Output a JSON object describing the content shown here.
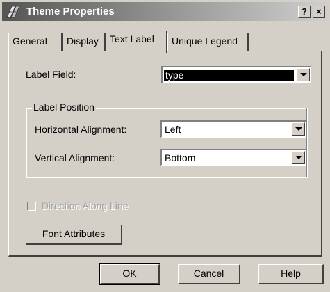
{
  "window": {
    "title": "Theme Properties",
    "help_glyph": "?",
    "close_glyph": "×",
    "icon": "theme-app-icon"
  },
  "tabs": [
    {
      "label": "General",
      "active": false
    },
    {
      "label": "Display",
      "active": false
    },
    {
      "label": "Text Label",
      "active": true
    },
    {
      "label": "Unique Legend",
      "active": false
    }
  ],
  "text_label": {
    "label_field_label": "Label Field:",
    "label_field_value": "type",
    "label_position": {
      "group_title": "Label Position",
      "horizontal_label": "Horizontal Alignment:",
      "horizontal_value": "Left",
      "vertical_label": "Vertical Alignment:",
      "vertical_value": "Bottom"
    },
    "direction_label": "Direction Along Line",
    "direction_checked": false,
    "direction_enabled": false,
    "font_attributes_button": {
      "mnemonic": "F",
      "rest": "ont Attributes"
    }
  },
  "buttons": {
    "ok": "OK",
    "cancel": "Cancel",
    "help": "Help"
  }
}
